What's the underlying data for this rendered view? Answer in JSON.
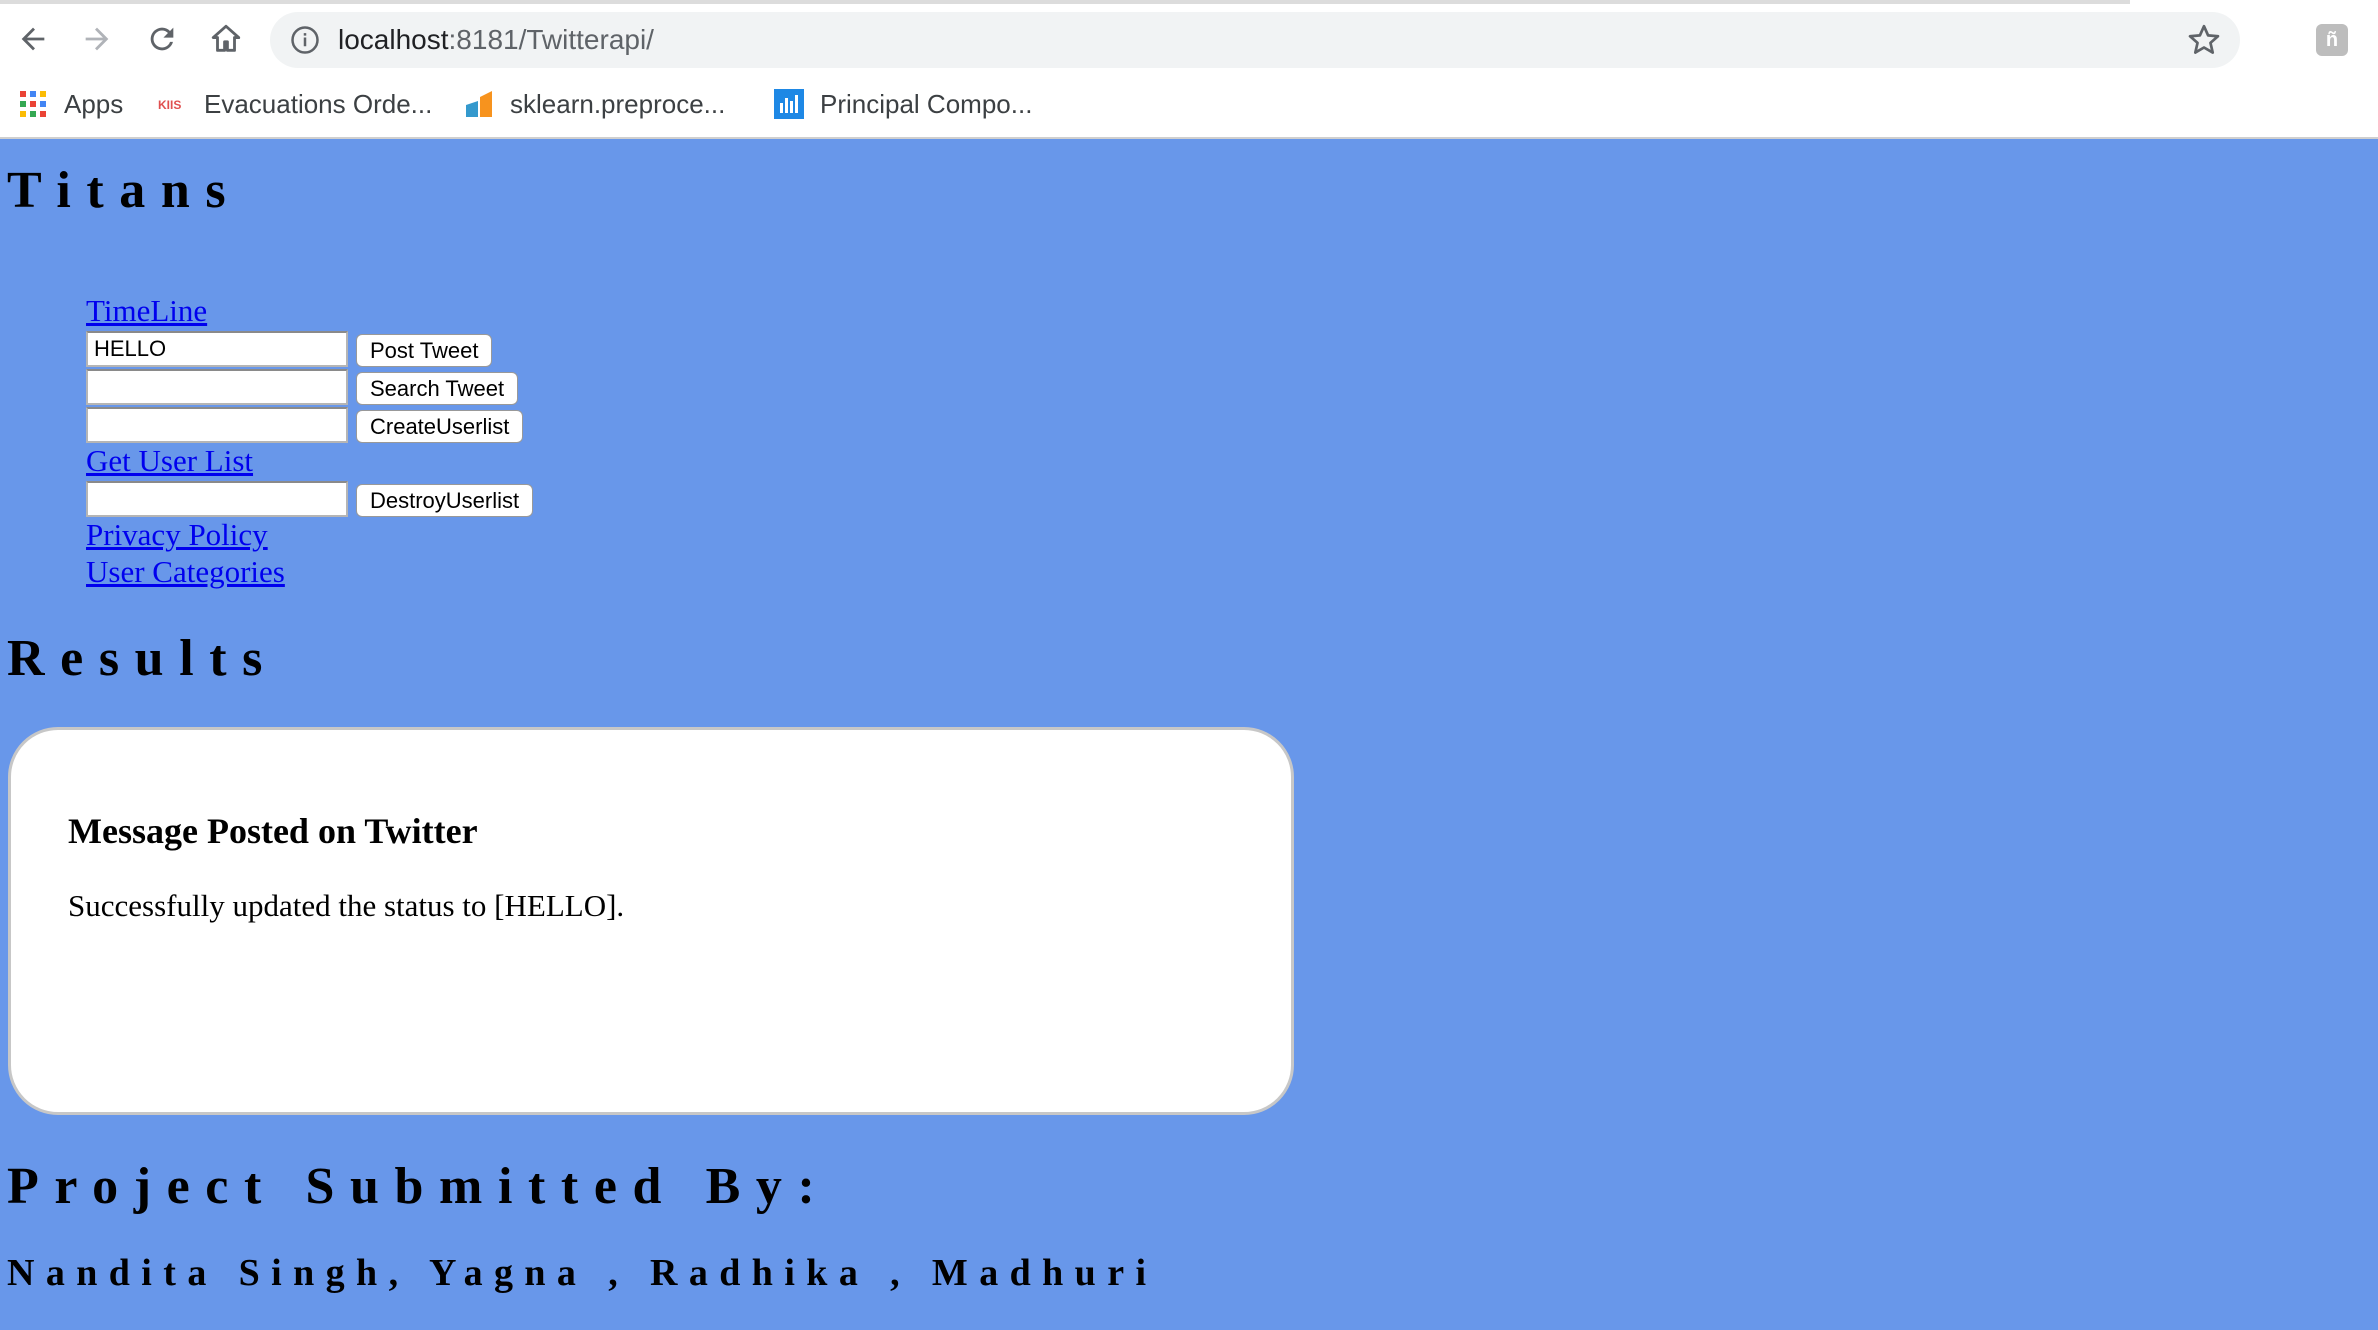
{
  "browser": {
    "url_host": "localhost",
    "url_path": ":8181/Twitterapi/",
    "bookmarks": [
      {
        "label": "Apps",
        "icon": "apps-grid-icon"
      },
      {
        "label": "Evacuations Orde...",
        "icon": "kiis-favicon"
      },
      {
        "label": "sklearn.preproce...",
        "icon": "sklearn-favicon"
      },
      {
        "label": "Principal Compo...",
        "icon": "chart-favicon"
      }
    ],
    "extension_glyph": "ñ"
  },
  "page": {
    "site_title": "Titans",
    "menu": {
      "timeline_link": "TimeLine",
      "post_input_value": "HELLO",
      "post_button": "Post Tweet",
      "search_input_value": "",
      "search_button": "Search Tweet",
      "create_input_value": "",
      "create_button": "CreateUserlist",
      "get_user_list_link": "Get User List",
      "destroy_input_value": "",
      "destroy_button": "DestroyUserlist",
      "privacy_link": "Privacy Policy",
      "categories_link": "User Categories"
    },
    "results_title": "Results",
    "result": {
      "heading": "Message Posted on Twitter",
      "message": "Successfully updated the status to [HELLO]."
    },
    "footer_title": "Project Submitted By:",
    "footer_names": "Nandita Singh, Yagna , Radhika , Madhuri"
  },
  "colors": {
    "page_background": "#6897ea",
    "link": "#0000ee",
    "card_background": "#ffffff"
  }
}
